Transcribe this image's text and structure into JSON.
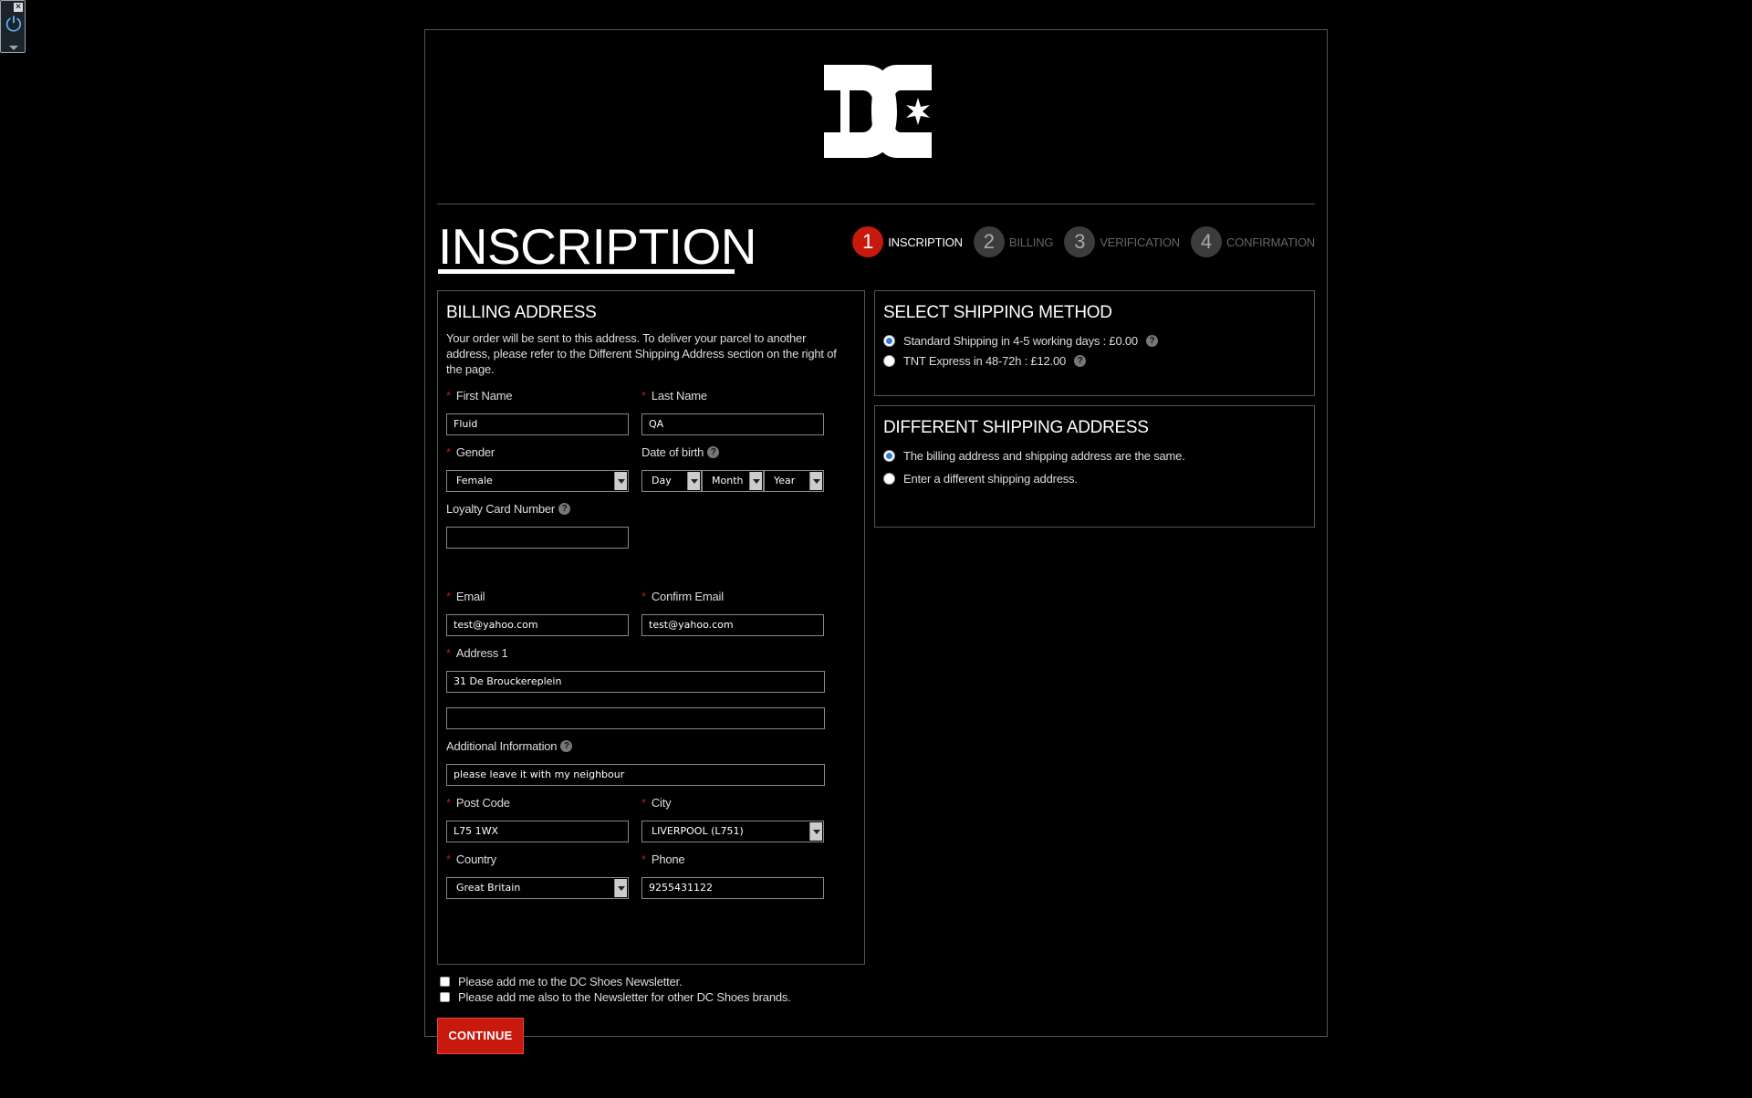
{
  "widget": {
    "close_glyph": "✕",
    "power_glyph": "⏻"
  },
  "header": {
    "logo_text": "DC"
  },
  "page": {
    "title": "INSCRIPTION"
  },
  "steps": [
    {
      "num": "1",
      "label": "INSCRIPTION",
      "active": true
    },
    {
      "num": "2",
      "label": "BILLING",
      "active": false
    },
    {
      "num": "3",
      "label": "VERIFICATION",
      "active": false
    },
    {
      "num": "4",
      "label": "CONFIRMATION",
      "active": false
    }
  ],
  "billing": {
    "title": "BILLING ADDRESS",
    "intro": "Your order will be sent to this address. To deliver your parcel to another address, please refer to the Different Shipping Address section on the right of the page.",
    "required_mark": "*",
    "help_glyph": "?",
    "first_name": {
      "label": "First Name",
      "value": "Fluid"
    },
    "last_name": {
      "label": "Last Name",
      "value": "QA"
    },
    "gender": {
      "label": "Gender",
      "value": "Female"
    },
    "dob": {
      "label": "Date of birth",
      "day": "Day",
      "month": "Month",
      "year": "Year"
    },
    "loyalty": {
      "label": "Loyalty Card Number",
      "value": ""
    },
    "email": {
      "label": "Email",
      "value": "test@yahoo.com"
    },
    "confirm_email": {
      "label": "Confirm Email",
      "value": "test@yahoo.com"
    },
    "address1": {
      "label": "Address 1",
      "value": "31 De Brouckereplein",
      "line2": ""
    },
    "additional": {
      "label": "Additional Information",
      "value": "please leave it with my neighbour"
    },
    "post_code": {
      "label": "Post Code",
      "value": "L75 1WX"
    },
    "city": {
      "label": "City",
      "value": "LIVERPOOL (L751)"
    },
    "country": {
      "label": "Country",
      "value": "Great Britain"
    },
    "phone": {
      "label": "Phone",
      "value": "9255431122"
    }
  },
  "shipping_method": {
    "title": "SELECT SHIPPING METHOD",
    "options": [
      {
        "label": "Standard Shipping in 4-5 working days : £0.00",
        "selected": true
      },
      {
        "label": "TNT Express in 48-72h : £12.00",
        "selected": false
      }
    ]
  },
  "different_shipping": {
    "title": "DIFFERENT SHIPPING ADDRESS",
    "options": [
      {
        "label": "The billing address and shipping address are the same.",
        "selected": true
      },
      {
        "label": "Enter a different shipping address.",
        "selected": false
      }
    ]
  },
  "newsletter": {
    "dc": "Please add me to the DC Shoes Newsletter.",
    "others": "Please add me also to the Newsletter for other DC Shoes brands."
  },
  "actions": {
    "continue": "CONTINUE"
  },
  "colors": {
    "accent": "#c8190e",
    "background": "#000000",
    "border": "#555555"
  }
}
